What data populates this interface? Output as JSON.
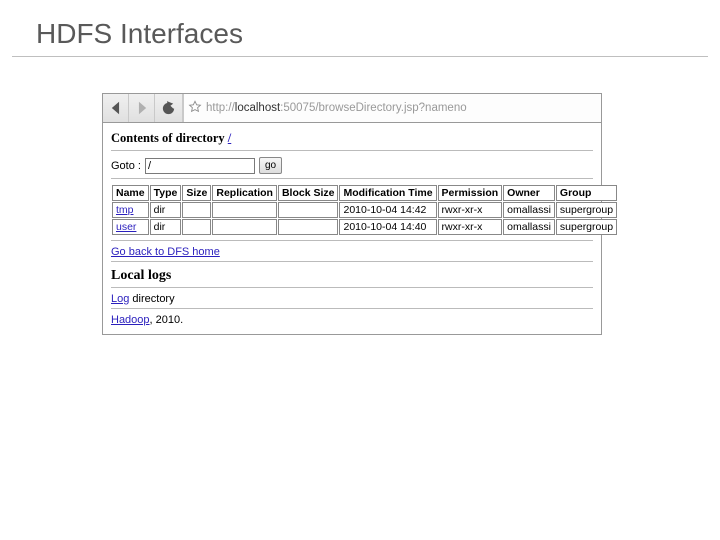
{
  "slide": {
    "title": "HDFS Interfaces"
  },
  "browser": {
    "url_prefix": "http://",
    "url_host": "localhost",
    "url_rest": ":50075/browseDirectory.jsp?nameno"
  },
  "page": {
    "contents_label": "Contents of directory ",
    "root_path": "/",
    "goto_label": "Goto :",
    "goto_value": "/",
    "go_btn": "go",
    "cols": {
      "name": "Name",
      "type": "Type",
      "size": "Size",
      "replication": "Replication",
      "block_size": "Block Size",
      "mtime": "Modification Time",
      "perm": "Permission",
      "owner": "Owner",
      "group": "Group"
    },
    "rows": [
      {
        "name": "tmp",
        "type": "dir",
        "size": "",
        "replication": "",
        "block_size": "",
        "mtime": "2010-10-04 14:42",
        "perm": "rwxr-xr-x",
        "owner": "omallassi",
        "group": "supergroup"
      },
      {
        "name": "user",
        "type": "dir",
        "size": "",
        "replication": "",
        "block_size": "",
        "mtime": "2010-10-04 14:40",
        "perm": "rwxr-xr-x",
        "owner": "omallassi",
        "group": "supergroup"
      }
    ],
    "back_link": "Go back to DFS home",
    "local_logs_heading": "Local logs",
    "log_link": "Log",
    "log_suffix": " directory",
    "footer_link": "Hadoop",
    "footer_suffix": ", 2010."
  }
}
